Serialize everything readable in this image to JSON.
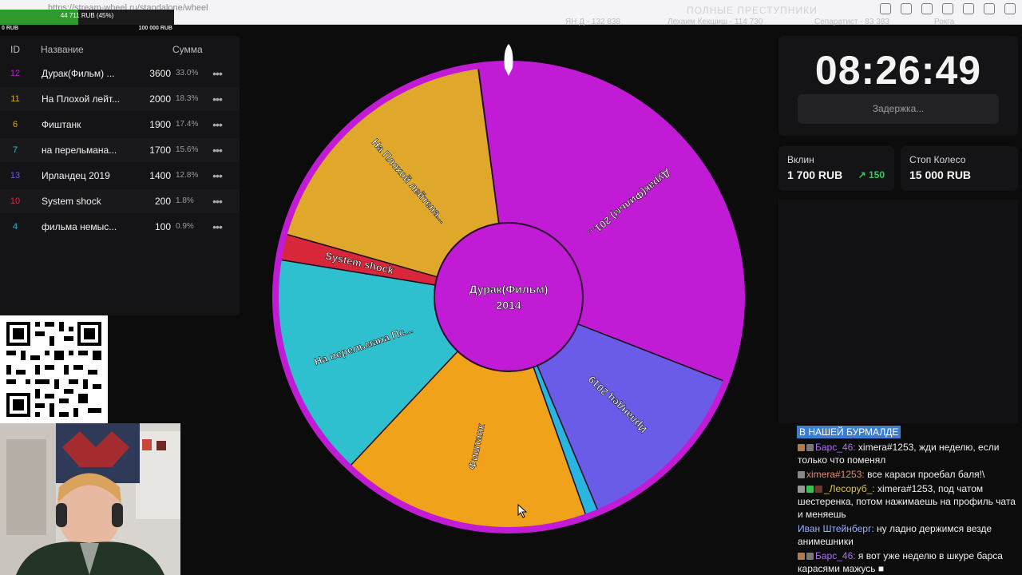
{
  "browser": {
    "url": "https://stream-wheel.ru/standalone/wheel",
    "tab_title": "ПОЛНЫЕ ПРЕСТУПНИКИ"
  },
  "progress": {
    "label": "44 711 RUB (45%)",
    "percent": 45,
    "min": "0 RUB",
    "max": "100 000 RUB"
  },
  "stats": [
    "ЯН Д - 132 838",
    "Лехаим Кекшиш - 114 730",
    "Сепаратист - 83 383",
    "Рокга"
  ],
  "list": {
    "headers": {
      "id": "ID",
      "name": "Название",
      "sum": "Сумма"
    },
    "rows": [
      {
        "id": "12",
        "name": "Дурак(Фильм) ...",
        "sum": "3600",
        "pct": "33.0%",
        "color": "#c21bd6"
      },
      {
        "id": "11",
        "name": "На Плохой лейт...",
        "sum": "2000",
        "pct": "18.3%",
        "color": "#e0a82a"
      },
      {
        "id": "6",
        "name": "Фиштанк",
        "sum": "1900",
        "pct": "17.4%",
        "color": "#f0a21b"
      },
      {
        "id": "7",
        "name": " на перельмана...",
        "sum": "1700",
        "pct": "15.6%",
        "color": "#2fc0cf"
      },
      {
        "id": "13",
        "name": "Ирландец 2019",
        "sum": "1400",
        "pct": "12.8%",
        "color": "#6a5be8"
      },
      {
        "id": "10",
        "name": "System shock",
        "sum": "200",
        "pct": "1.8%",
        "color": "#d8263a"
      },
      {
        "id": "4",
        "name": "фильма немыс...",
        "sum": "100",
        "pct": "0.9%",
        "color": "#28b6e0"
      }
    ]
  },
  "wheel": {
    "center_line1": "Дурак(Фильм)",
    "center_line2": "2014",
    "rim_color": "#c21bd6",
    "segments": [
      {
        "label": "Дурак(Фильм) 201...",
        "color": "#c21bd6",
        "start": 0,
        "end": 118.8
      },
      {
        "label": "Ирландец 2019",
        "color": "#6a5be8",
        "start": 118.8,
        "end": 164.8
      },
      {
        "label": "",
        "color": "#28b6e0",
        "start": 164.8,
        "end": 168.0
      },
      {
        "label": "Фиштанк",
        "color": "#f0a21b",
        "start": 168.0,
        "end": 230.7
      },
      {
        "label": "На перельмана Пс...",
        "color": "#2fc0cf",
        "start": 230.7,
        "end": 286.8
      },
      {
        "label": "System shock",
        "color": "#d8263a",
        "start": 286.8,
        "end": 293.3
      },
      {
        "label": "На Плохой лейтена...",
        "color": "#e0a82a",
        "start": 293.3,
        "end": 359.9
      }
    ]
  },
  "timer": {
    "time": "08:26:49",
    "delay_label": "Задержка..."
  },
  "cards": [
    {
      "key": "Вклин",
      "value": "1 700 RUB",
      "badge": "150"
    },
    {
      "key": "Стоп Колесо",
      "value": "15 000 RUB",
      "badge": ""
    }
  ],
  "chat": {
    "title": "В НАШЕЙ БУРМАЛДЕ",
    "messages": [
      {
        "user": "Барс_46:",
        "text": "ximera#1253, жди неделю, если только что поменял"
      },
      {
        "user": "ximera#1253:",
        "text": "все караси проебал баля!\\"
      },
      {
        "user": "_Лесоруб_:",
        "text": "ximera#1253, под чатом шестеренка, потом нажимаешь на профиль чата и меняешь"
      },
      {
        "user": "Иван Штейнберг:",
        "text": "ну ладно держимся везде анимешники"
      },
      {
        "user": "Барс_46:",
        "text": "я вот уже неделю в шкуре барса карасями мажусь ■"
      }
    ]
  }
}
